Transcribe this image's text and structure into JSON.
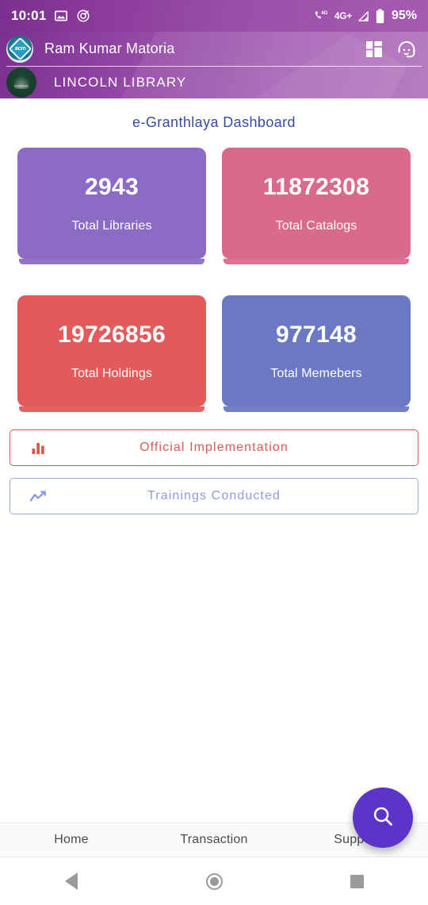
{
  "status_bar": {
    "time": "10:01",
    "icons": [
      "image-icon",
      "do-not-disturb-icon"
    ],
    "call_network": "4G",
    "network_label": "4G+",
    "battery_percent": "95%"
  },
  "app_bar": {
    "user_name": "Ram Kumar Matoria",
    "user_avatar": "acm-logo-avatar",
    "actions": [
      {
        "name": "dashboard-grid-icon",
        "label": "Dashboard"
      },
      {
        "name": "support-headset-icon",
        "label": "Support"
      }
    ],
    "library_name": "LINCOLN LIBRARY",
    "library_logo": "lincoln-library-crest"
  },
  "main": {
    "page_title": "e-Granthlaya Dashboard",
    "stat_cards": [
      {
        "value": "2943",
        "label": "Total Libraries",
        "color": "#8B6BC4"
      },
      {
        "value": "11872308",
        "label": "Total Catalogs",
        "color": "#D96B8A"
      },
      {
        "value": "19726856",
        "label": "Total Holdings",
        "color": "#E25A5A"
      },
      {
        "value": "977148",
        "label": "Total Memebers",
        "color": "#6B79C4"
      }
    ],
    "action_buttons": [
      {
        "label": "Official Implementation",
        "icon": "bar-chart-icon",
        "color": "#DB5A4F",
        "border": "#D9594E"
      },
      {
        "label": "Trainings Conducted",
        "icon": "line-chart-icon",
        "color": "#8D9BDE",
        "border": "#9AA6E0"
      }
    ]
  },
  "fab": {
    "icon": "search-icon",
    "color": "#5B34C8"
  },
  "bottom_nav": {
    "items": [
      {
        "label": "Home"
      },
      {
        "label": "Transaction"
      },
      {
        "label": "Support"
      }
    ]
  },
  "system_nav": {
    "back": "back-triangle-icon",
    "home": "home-circle-icon",
    "recents": "recents-square-icon"
  }
}
